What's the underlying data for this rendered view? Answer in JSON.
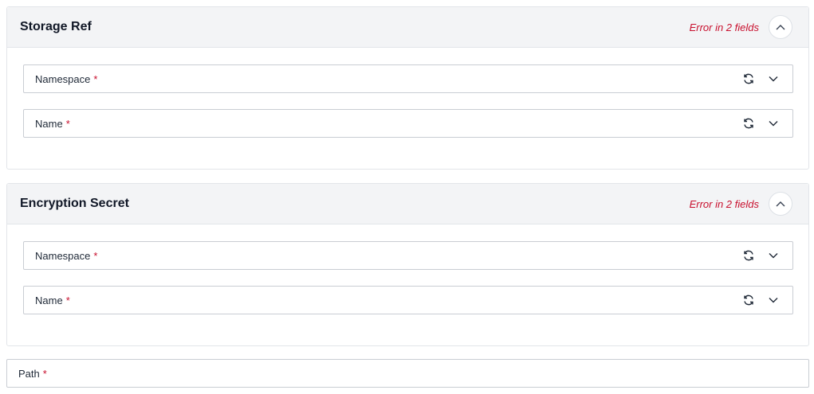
{
  "sections": [
    {
      "title": "Storage Ref",
      "error": "Error in 2 fields",
      "fields": [
        {
          "label": "Namespace",
          "required_mark": "*"
        },
        {
          "label": "Name",
          "required_mark": "*"
        }
      ]
    },
    {
      "title": "Encryption Secret",
      "error": "Error in 2 fields",
      "fields": [
        {
          "label": "Namespace",
          "required_mark": "*"
        },
        {
          "label": "Name",
          "required_mark": "*"
        }
      ]
    }
  ],
  "path_field": {
    "label": "Path",
    "required_mark": "*"
  },
  "icons": {
    "collapse": "chevron-up-icon",
    "refresh": "refresh-icon",
    "dropdown": "chevron-down-icon"
  },
  "colors": {
    "error": "#c8102e",
    "header_bg": "#f3f4f6"
  }
}
